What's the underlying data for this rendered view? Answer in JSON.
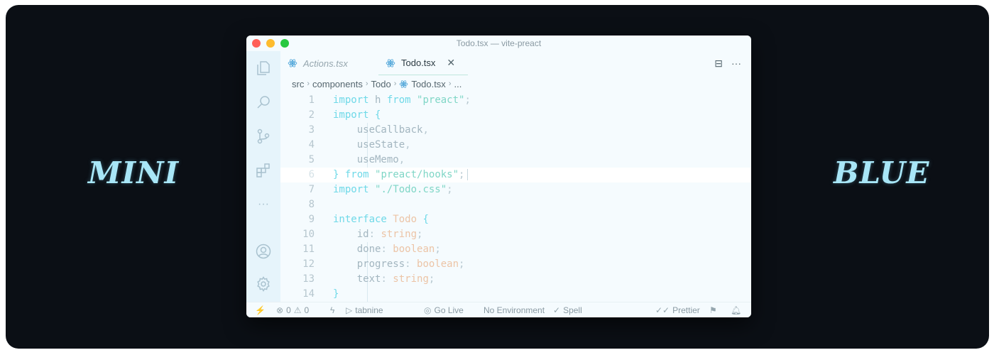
{
  "side_text": {
    "left": "MINI",
    "right": "BLUE"
  },
  "window": {
    "title": "Todo.tsx — vite-preact"
  },
  "tabs": [
    {
      "label": "Actions.tsx",
      "icon": "react-icon"
    },
    {
      "label": "Todo.tsx",
      "icon": "react-icon",
      "active": true
    }
  ],
  "tab_tools": {
    "split": "⊟",
    "more": "···"
  },
  "breadcrumb": [
    "src",
    "components",
    "Todo",
    "Todo.tsx",
    "..."
  ],
  "code": {
    "lines": [
      {
        "n": "1",
        "tokens": [
          [
            "k",
            "import"
          ],
          [
            "id",
            " h "
          ],
          [
            "k",
            "from"
          ],
          [
            "id",
            " "
          ],
          [
            "s",
            "\"preact\""
          ],
          [
            "p",
            ";"
          ]
        ]
      },
      {
        "n": "2",
        "tokens": [
          [
            "k",
            "import"
          ],
          [
            "id",
            " "
          ],
          [
            "br",
            "{"
          ]
        ]
      },
      {
        "n": "3",
        "tokens": [
          [
            "id",
            "    useCallback"
          ],
          [
            "p",
            ","
          ]
        ]
      },
      {
        "n": "4",
        "tokens": [
          [
            "id",
            "    useState"
          ],
          [
            "p",
            ","
          ]
        ]
      },
      {
        "n": "5",
        "tokens": [
          [
            "id",
            "    useMemo"
          ],
          [
            "p",
            ","
          ]
        ]
      },
      {
        "n": "6",
        "tokens": [
          [
            "br",
            "}"
          ],
          [
            "id",
            " "
          ],
          [
            "k",
            "from"
          ],
          [
            "id",
            " "
          ],
          [
            "s",
            "\"preact/hooks\""
          ],
          [
            "p",
            ";"
          ]
        ],
        "active": true
      },
      {
        "n": "7",
        "tokens": [
          [
            "k",
            "import"
          ],
          [
            "id",
            " "
          ],
          [
            "s",
            "\"./Todo.css\""
          ],
          [
            "p",
            ";"
          ]
        ]
      },
      {
        "n": "8",
        "tokens": []
      },
      {
        "n": "9",
        "tokens": [
          [
            "k",
            "interface"
          ],
          [
            "id",
            " "
          ],
          [
            "t",
            "Todo"
          ],
          [
            "id",
            " "
          ],
          [
            "br",
            "{"
          ]
        ]
      },
      {
        "n": "10",
        "tokens": [
          [
            "id",
            "    id"
          ],
          [
            "p",
            ": "
          ],
          [
            "t",
            "string"
          ],
          [
            "p",
            ";"
          ]
        ]
      },
      {
        "n": "11",
        "tokens": [
          [
            "id",
            "    done"
          ],
          [
            "p",
            ": "
          ],
          [
            "t",
            "boolean"
          ],
          [
            "p",
            ";"
          ]
        ]
      },
      {
        "n": "12",
        "tokens": [
          [
            "id",
            "    progress"
          ],
          [
            "p",
            ": "
          ],
          [
            "t",
            "boolean"
          ],
          [
            "p",
            ";"
          ]
        ]
      },
      {
        "n": "13",
        "tokens": [
          [
            "id",
            "    text"
          ],
          [
            "p",
            ": "
          ],
          [
            "t",
            "string"
          ],
          [
            "p",
            ";"
          ]
        ]
      },
      {
        "n": "14",
        "tokens": [
          [
            "br",
            "}"
          ]
        ]
      }
    ]
  },
  "status": {
    "errors": "0",
    "warnings": "0",
    "tabnine": "tabnine",
    "golive": "Go Live",
    "environment": "No Environment",
    "spell": "Spell",
    "prettier": "Prettier"
  },
  "colors": {
    "background": "#0b0f15",
    "editor_bg": "#f5fbfe",
    "accent": "#a8e6f7",
    "keyword": "#6fd9e8",
    "string": "#7fd6c6",
    "type": "#ecc4a6"
  }
}
